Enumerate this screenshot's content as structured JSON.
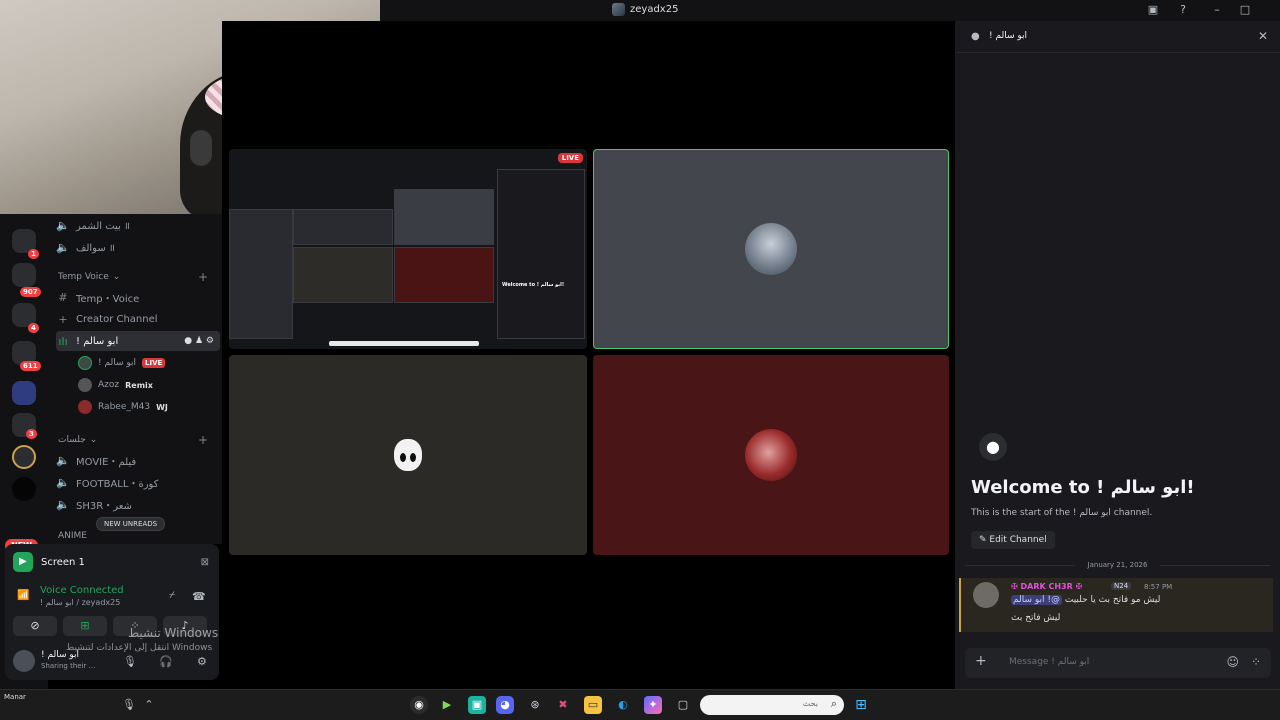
{
  "window": {
    "title": "zeyadx25"
  },
  "server_rail": {
    "badges": [
      "1",
      "907",
      "4",
      "611",
      "3"
    ],
    "new_label": "NEW"
  },
  "sidebar": {
    "top_channels": [
      {
        "name": "بيت الشمر ॥"
      },
      {
        "name": "سوالف ॥"
      }
    ],
    "temp_voice_category": "Temp Voice",
    "temp_voice_channel": "Temp・Voice",
    "creator_channel": "Creator Channel",
    "active_channel": "! ابو سالم",
    "voice_users": [
      {
        "name": "! ابو سالم",
        "live": "LIVE"
      },
      {
        "name": "Azoz",
        "tag": "Remix"
      },
      {
        "name": "Rabee_M43",
        "tag": "WJ"
      }
    ],
    "jalsat_category": "جلسات",
    "jalsat_channels": [
      {
        "name": "MOVIE・فيلم"
      },
      {
        "name": "FOOTBALL・كورة"
      },
      {
        "name": "SH3R・شعر"
      }
    ],
    "anime_category": "ANIME",
    "new_unreads": "NEW UNREADS"
  },
  "panel": {
    "screen_label": "Screen 1",
    "voice_connected": "Voice Connected",
    "voice_sub": "! ابو سالم / zeyadx25",
    "user_name": "! ابو سالم",
    "user_status": "Sharing their ..."
  },
  "watermark": {
    "line1": "تنشيط Windows",
    "line2": "انتقل إلى الإعدادات لتنشيط Windows"
  },
  "stage": {
    "live_label": "LIVE",
    "mini_welcome": "Welcome to ! ابو سالم!"
  },
  "chat": {
    "channel_name": "! ابو سالم",
    "welcome_title": "Welcome to ! ابو سالم!",
    "welcome_sub": "This is the start of the ! ابو سالم channel.",
    "edit_channel": "Edit Channel",
    "date": "January 21, 2026",
    "message": {
      "author": "✠ DARK CH3R ✠",
      "tag": "N24",
      "time": "8:57 PM",
      "mention": "@! ابو سالم",
      "text1": "ليش مو فاتح بث يا حلبيت",
      "text2": "ليش فاتح بث"
    },
    "composer_placeholder": "Message ! ابو سالم"
  },
  "taskbar": {
    "search_placeholder": "بحث",
    "tray_name": "Manar"
  },
  "colors": {
    "accent_green": "#23a559",
    "live_red": "#da373c",
    "mention_bg": "#3c3f7a"
  }
}
